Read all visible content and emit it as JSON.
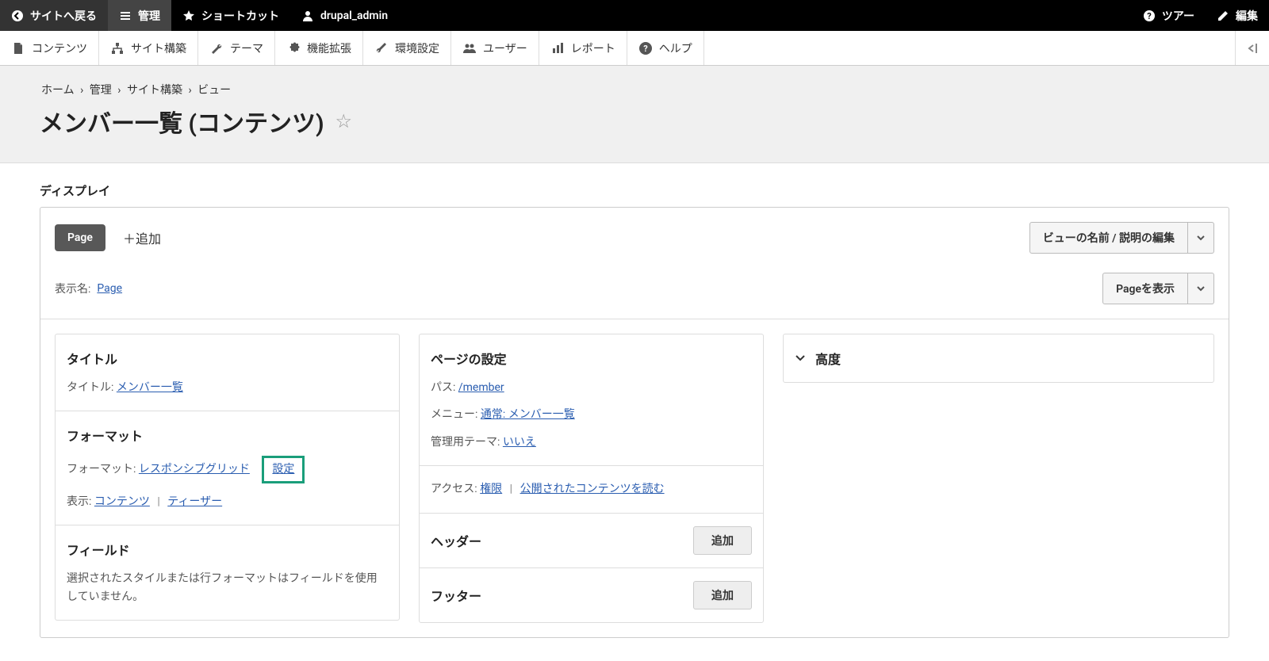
{
  "toolbar": {
    "back": "サイトへ戻る",
    "manage": "管理",
    "shortcuts": "ショートカット",
    "user": "drupal_admin",
    "tour": "ツアー",
    "edit": "編集"
  },
  "subnav": {
    "content": "コンテンツ",
    "structure": "サイト構築",
    "appearance": "テーマ",
    "extend": "機能拡張",
    "config": "環境設定",
    "people": "ユーザー",
    "reports": "レポート",
    "help": "ヘルプ"
  },
  "breadcrumb": {
    "home": "ホーム",
    "admin": "管理",
    "structure": "サイト構築",
    "views": "ビュー",
    "sep": "›"
  },
  "page_title": "メンバー一覧 (コンテンツ)",
  "displays_label": "ディスプレイ",
  "tab_page": "Page",
  "add_display": "＋追加",
  "edit_view_name": "ビューの名前 / 説明の編集",
  "display_name_label": "表示名:",
  "display_name_value": "Page",
  "view_page_btn": "Pageを表示",
  "left_col": {
    "title_heading": "タイトル",
    "title_label": "タイトル:",
    "title_value": "メンバー一覧",
    "format_heading": "フォーマット",
    "format_label": "フォーマット:",
    "format_value": "レスポンシブグリッド",
    "format_settings": "設定",
    "show_label": "表示:",
    "show_value": "コンテンツ",
    "show_teaser": "ティーザー",
    "fields_heading": "フィールド",
    "fields_desc": "選択されたスタイルまたは行フォーマットはフィールドを使用していません。"
  },
  "mid_col": {
    "page_settings_heading": "ページの設定",
    "path_label": "パス:",
    "path_value": "/member",
    "menu_label": "メニュー:",
    "menu_value": "通常: メンバー一覧",
    "admin_theme_label": "管理用テーマ:",
    "admin_theme_value": "いいえ",
    "access_label": "アクセス:",
    "access_value": "権限",
    "access_perm": "公開されたコンテンツを読む",
    "header_heading": "ヘッダー",
    "footer_heading": "フッター",
    "add_btn": "追加"
  },
  "right_col": {
    "advanced": "高度"
  }
}
